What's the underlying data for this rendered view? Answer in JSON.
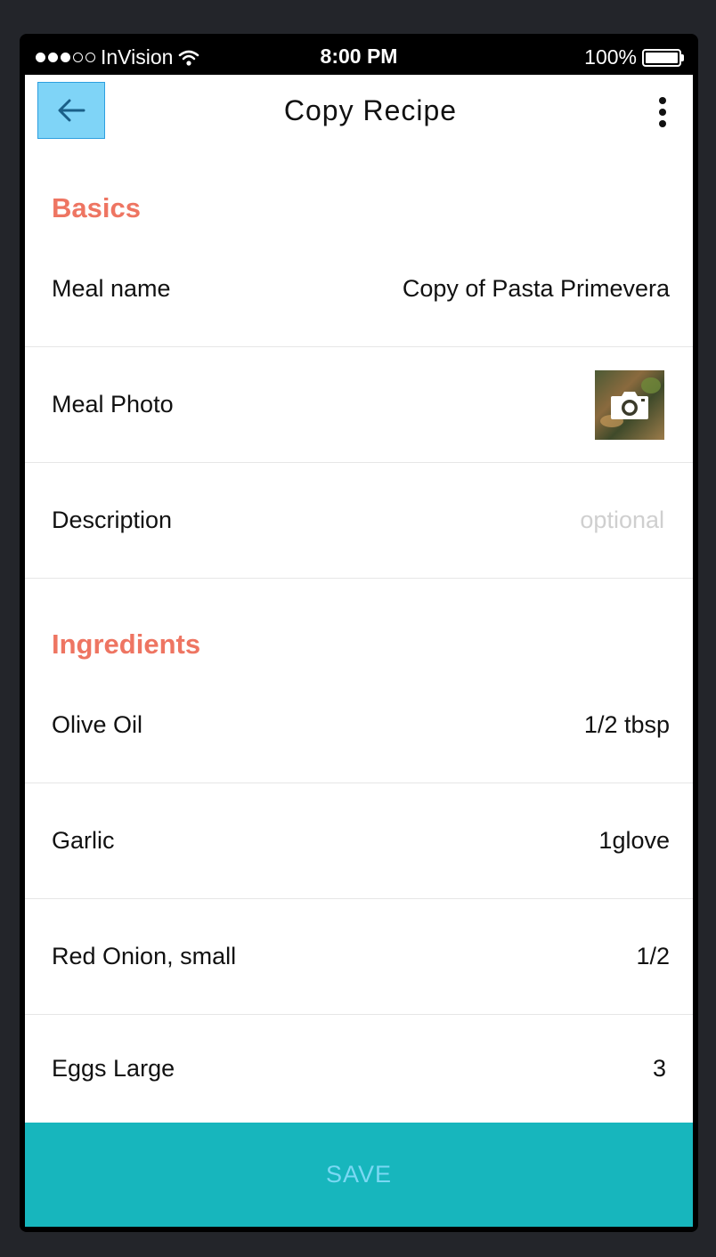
{
  "status_bar": {
    "carrier": "InVision",
    "time": "8:00 PM",
    "battery": "100%",
    "signal_bars_filled": 3,
    "signal_bars_total": 5
  },
  "header": {
    "title": "Copy Recipe",
    "back_icon": "arrow-left-icon",
    "more_icon": "more-vertical-icon"
  },
  "sections": {
    "basics": {
      "heading": "Basics",
      "meal_name": {
        "label": "Meal name",
        "value": "Copy of Pasta Primevera"
      },
      "meal_photo": {
        "label": "Meal Photo",
        "icon": "camera-icon"
      },
      "description": {
        "label": "Description",
        "placeholder": "optional"
      }
    },
    "ingredients": {
      "heading": "Ingredients",
      "items": [
        {
          "name": "Olive Oil",
          "amount": "1/2 tbsp"
        },
        {
          "name": "Garlic",
          "amount": "1glove"
        },
        {
          "name": "Red Onion, small",
          "amount": "1/2"
        },
        {
          "name": "Eggs Large",
          "amount": "3"
        }
      ]
    }
  },
  "footer": {
    "save_label": "SAVE"
  },
  "colors": {
    "accent": "#ee7562",
    "save_bar": "#17b6bd",
    "save_text": "#7ad8f3",
    "back_button_bg": "#7fd4f7",
    "back_button_border": "#2d9fe0",
    "back_icon": "#1a5f88",
    "placeholder": "#cfcfcf"
  }
}
